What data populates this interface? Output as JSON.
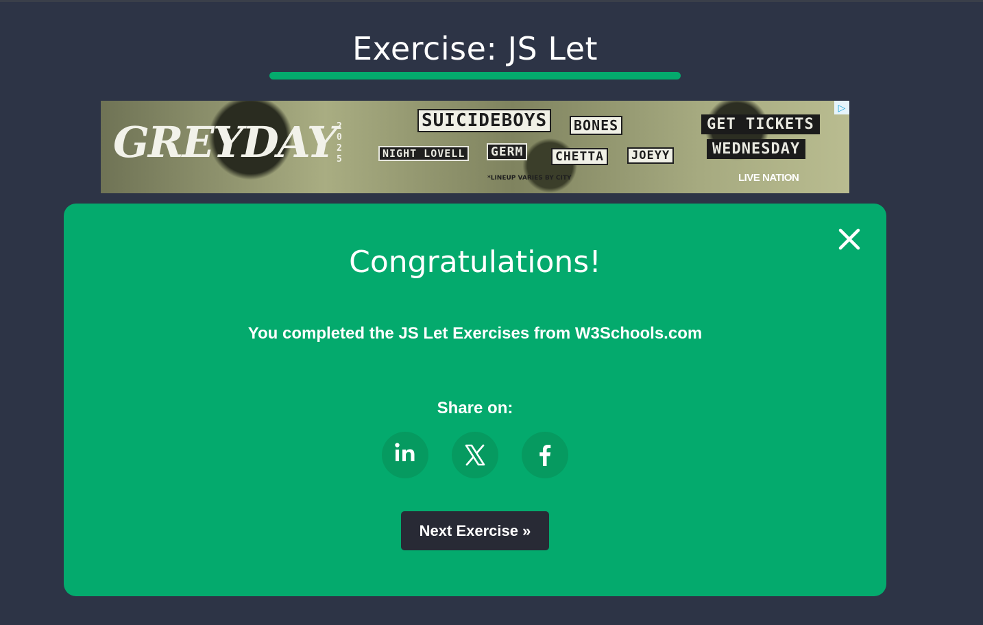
{
  "page": {
    "title": "Exercise: JS Let"
  },
  "ad": {
    "brand": "GREYDAY",
    "year": "2025",
    "artists": [
      "SUICIDEBOYS",
      "BONES",
      "NIGHT LOVELL",
      "GERM",
      "CHETTA",
      "JOEYY"
    ],
    "note": "*LINEUP VARIES BY CITY",
    "cta_line1": "GET TICKETS",
    "cta_line2": "WEDNESDAY",
    "sponsor": "LIVE NATION",
    "adchoices_icon": "adchoices-icon"
  },
  "modal": {
    "heading": "Congratulations!",
    "message": "You completed the JS Let Exercises from W3Schools.com",
    "share_label": "Share on:",
    "share_buttons": [
      {
        "icon": "linkedin-icon",
        "label": "in"
      },
      {
        "icon": "x-icon",
        "label": "X"
      },
      {
        "icon": "facebook-icon",
        "label": "f"
      }
    ],
    "next_label": "Next Exercise »",
    "close_icon": "close-icon"
  },
  "colors": {
    "background": "#2d3446",
    "accent": "#04aa6d",
    "share_circle": "#069a60",
    "next_button": "#282a35"
  }
}
